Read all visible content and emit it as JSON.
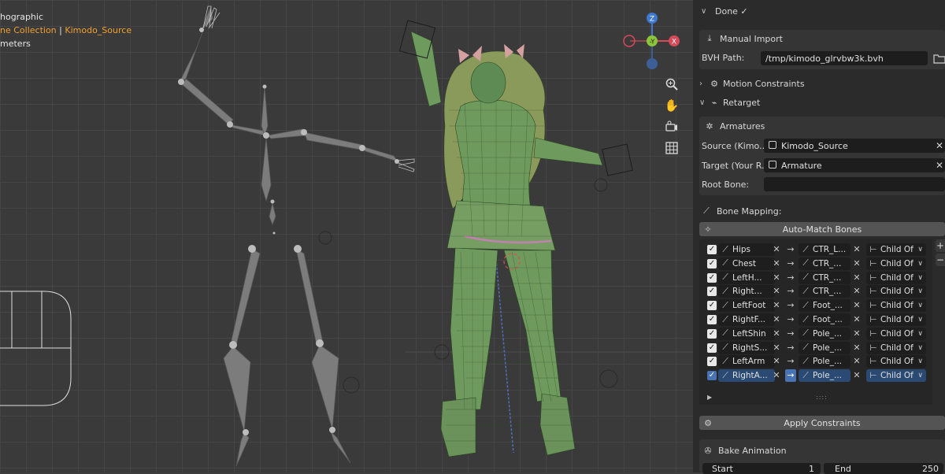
{
  "viewport": {
    "view_label": "hographic",
    "collection": "ne Collection",
    "separator": "|",
    "object": "Kimodo_Source",
    "units": "meters",
    "gizmo": {
      "z": "Z",
      "y": "-Y",
      "x": "X"
    },
    "nav_icons": [
      "zoom-icon",
      "hand-pan-icon",
      "camera-icon",
      "grid-icon"
    ]
  },
  "panel": {
    "done_label": "Done ✓",
    "manual_import": {
      "title": "Manual Import",
      "bvh_label": "BVH Path:",
      "bvh_value": "/tmp/kimodo_glrvbw3k.bvh"
    },
    "motion_constraints": "Motion Constraints",
    "retarget": "Retarget",
    "armatures": {
      "title": "Armatures",
      "source_label": "Source (Kimo...",
      "source_value": "Kimodo_Source",
      "target_label": "Target (Your R...",
      "target_value": "Armature",
      "root_label": "Root Bone:",
      "root_value": ""
    },
    "bone_mapping": {
      "title": "Bone Mapping:",
      "auto_match": "Auto-Match Bones",
      "rows": [
        {
          "source": "Hips",
          "target": "CTR_L...",
          "constraint": "Child Of"
        },
        {
          "source": "Chest",
          "target": "CTR_...",
          "constraint": "Child Of"
        },
        {
          "source": "LeftH...",
          "target": "CTR_...",
          "constraint": "Child Of"
        },
        {
          "source": "Right...",
          "target": "CTR_...",
          "constraint": "Child Of"
        },
        {
          "source": "LeftFoot",
          "target": "Foot_...",
          "constraint": "Child Of"
        },
        {
          "source": "RightF...",
          "target": "Foot_...",
          "constraint": "Child Of"
        },
        {
          "source": "LeftShin",
          "target": "Pole_...",
          "constraint": "Child Of"
        },
        {
          "source": "RightS...",
          "target": "Pole_...",
          "constraint": "Child Of"
        },
        {
          "source": "LeftArm",
          "target": "Pole_...",
          "constraint": "Child Of"
        },
        {
          "source": "RightA...",
          "target": "Pole_...",
          "constraint": "Child Of"
        }
      ],
      "add_label": "+",
      "remove_label": "−"
    },
    "apply_constraints": "Apply Constraints",
    "bake": {
      "title": "Bake Animation",
      "start_label": "Start",
      "start_value": "1",
      "end_label": "End",
      "end_value": "250"
    }
  }
}
